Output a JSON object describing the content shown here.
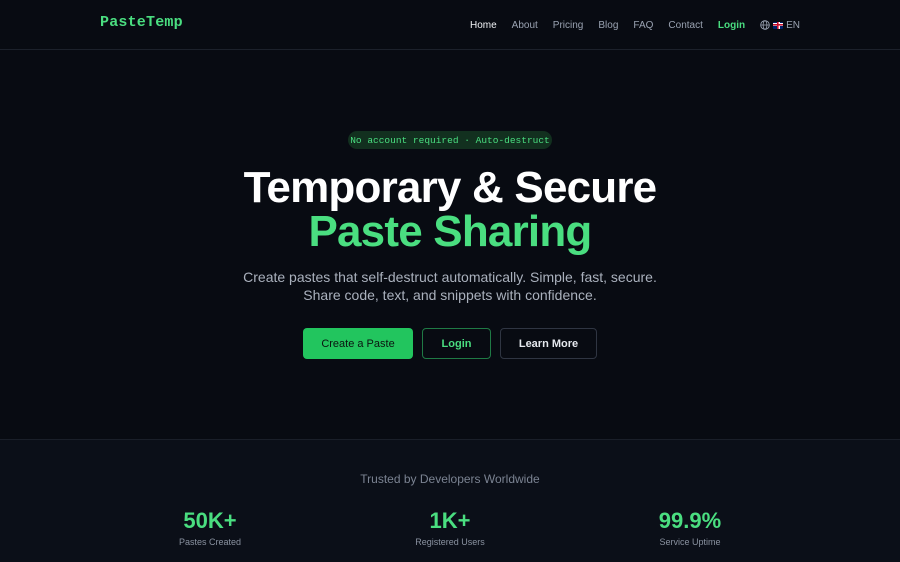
{
  "brand": {
    "name": "PasteTemp",
    "accent": "#4ade80"
  },
  "nav": {
    "links": [
      {
        "label": "Home"
      },
      {
        "label": "About"
      },
      {
        "label": "Pricing"
      },
      {
        "label": "Blog"
      },
      {
        "label": "FAQ"
      },
      {
        "label": "Contact"
      }
    ],
    "login": "Login",
    "language": {
      "icon": "globe-icon",
      "flag": "uk-flag-icon",
      "code": "EN"
    }
  },
  "hero": {
    "badge": "No account required · Auto-destruct",
    "title_line1": "Temporary & Secure",
    "title_line2": "Paste Sharing",
    "subtitle_line1": "Create pastes that self-destruct automatically. Simple, fast, secure.",
    "subtitle_line2": "Share code, text, and snippets with confidence.",
    "buttons": {
      "create": "Create a Paste",
      "login": "Login",
      "learn": "Learn More"
    }
  },
  "stats": {
    "heading": "Trusted by Developers Worldwide",
    "items": [
      {
        "value": "50K+",
        "label": "Pastes Created"
      },
      {
        "value": "1K+",
        "label": "Registered Users"
      },
      {
        "value": "99.9%",
        "label": "Service Uptime"
      }
    ]
  }
}
